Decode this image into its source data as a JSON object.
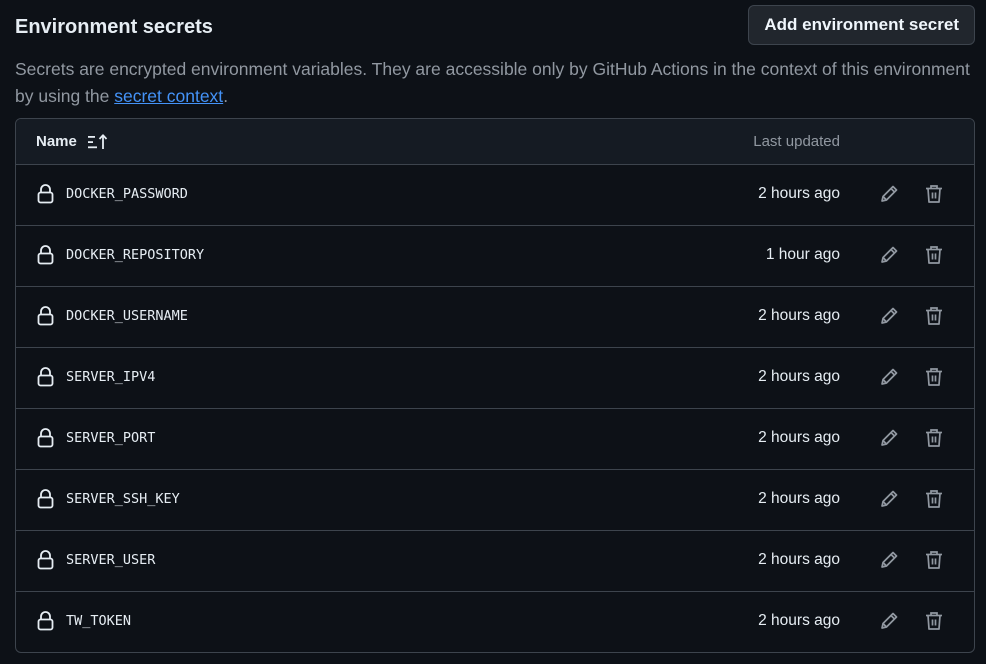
{
  "header": {
    "title": "Environment secrets",
    "add_button_label": "Add environment secret"
  },
  "description": {
    "text_before_link": "Secrets are encrypted environment variables. They are accessible only by GitHub Actions in the context of this environment by using the ",
    "link_text": "secret context",
    "text_after_link": "."
  },
  "table": {
    "columns": {
      "name": "Name",
      "last_updated": "Last updated"
    },
    "rows": [
      {
        "name": "DOCKER_PASSWORD",
        "updated": "2 hours ago"
      },
      {
        "name": "DOCKER_REPOSITORY",
        "updated": "1 hour ago"
      },
      {
        "name": "DOCKER_USERNAME",
        "updated": "2 hours ago"
      },
      {
        "name": "SERVER_IPV4",
        "updated": "2 hours ago"
      },
      {
        "name": "SERVER_PORT",
        "updated": "2 hours ago"
      },
      {
        "name": "SERVER_SSH_KEY",
        "updated": "2 hours ago"
      },
      {
        "name": "SERVER_USER",
        "updated": "2 hours ago"
      },
      {
        "name": "TW_TOKEN",
        "updated": "2 hours ago"
      }
    ]
  },
  "icons": {
    "sort": "sort-ascending-icon",
    "row_leading": "lock-icon",
    "edit": "pencil-icon",
    "delete": "trash-icon"
  },
  "colors": {
    "background": "#0d1117",
    "header_background": "#151b23",
    "border": "#3d444d",
    "text_primary": "#e6edf3",
    "text_muted": "#9198a1",
    "link": "#4493f8",
    "button_background": "#21262d"
  }
}
